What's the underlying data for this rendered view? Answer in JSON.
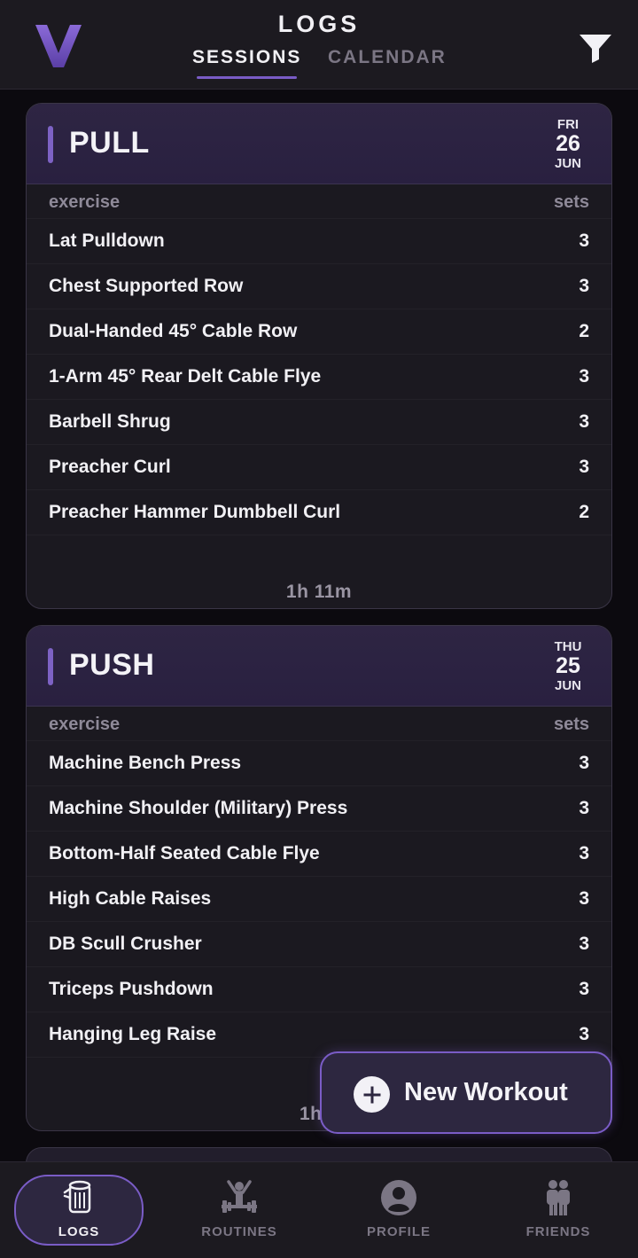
{
  "header": {
    "title": "LOGS",
    "tabs": [
      {
        "label": "SESSIONS",
        "active": true
      },
      {
        "label": "CALENDAR",
        "active": false
      }
    ],
    "logo_icon": "v-logo-icon",
    "filter_icon": "filter-icon"
  },
  "cards": [
    {
      "name": "PULL",
      "weekday": "FRI",
      "day": "26",
      "month": "JUN",
      "col_exercise": "exercise",
      "col_sets": "sets",
      "rows": [
        {
          "exercise": "Lat Pulldown",
          "sets": "3"
        },
        {
          "exercise": "Chest Supported Row",
          "sets": "3"
        },
        {
          "exercise": "Dual-Handed 45° Cable Row",
          "sets": "2"
        },
        {
          "exercise": "1-Arm 45° Rear Delt Cable Flye",
          "sets": "3"
        },
        {
          "exercise": "Barbell Shrug",
          "sets": "3"
        },
        {
          "exercise": "Preacher Curl",
          "sets": "3"
        },
        {
          "exercise": "Preacher Hammer Dumbbell Curl",
          "sets": "2"
        }
      ],
      "duration": "1h 11m"
    },
    {
      "name": "PUSH",
      "weekday": "THU",
      "day": "25",
      "month": "JUN",
      "col_exercise": "exercise",
      "col_sets": "sets",
      "rows": [
        {
          "exercise": "Machine Bench Press",
          "sets": "3"
        },
        {
          "exercise": "Machine Shoulder (Military) Press",
          "sets": "3"
        },
        {
          "exercise": "Bottom-Half Seated Cable Flye",
          "sets": "3"
        },
        {
          "exercise": "High Cable Raises",
          "sets": "3"
        },
        {
          "exercise": "DB Scull Crusher",
          "sets": "3"
        },
        {
          "exercise": "Triceps Pushdown",
          "sets": "3"
        },
        {
          "exercise": "Hanging Leg Raise",
          "sets": "3"
        }
      ],
      "duration": "1h 1"
    }
  ],
  "fab": {
    "label": "New Workout",
    "icon": "plus-circle-icon"
  },
  "nav": [
    {
      "label": "LOGS",
      "icon": "log-icon",
      "active": true
    },
    {
      "label": "ROUTINES",
      "icon": "weightlifter-icon",
      "active": false
    },
    {
      "label": "PROFILE",
      "icon": "user-circle-icon",
      "active": false
    },
    {
      "label": "FRIENDS",
      "icon": "friends-icon",
      "active": false
    }
  ],
  "colors": {
    "accent": "#7a5cc6",
    "background": "#0c0a0f",
    "card": "#1b1920",
    "card_header": "#2e2543"
  }
}
